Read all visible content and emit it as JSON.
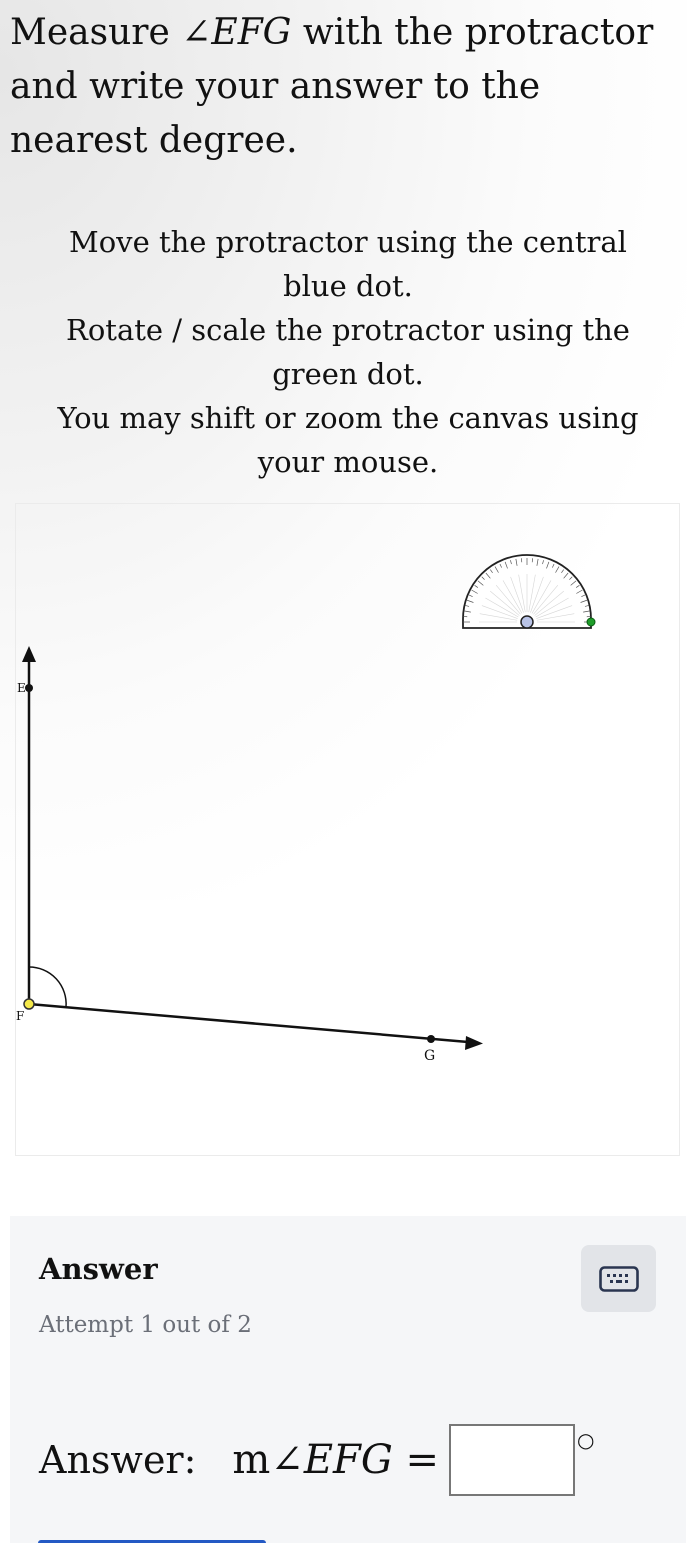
{
  "question": {
    "prefix": "Measure ",
    "angle_symbol": "∠",
    "angle_name": "EFG",
    "suffix": " with the protractor and write your answer to the nearest degree."
  },
  "instructions": [
    "Move the protractor using the central blue dot.",
    "Rotate / scale the protractor using the green dot.",
    "You may shift or zoom the canvas using your mouse."
  ],
  "canvas": {
    "points": {
      "E": "E",
      "F": "F",
      "G": "G"
    },
    "protractor": {
      "center_dot_color": "#b9c3e6",
      "handle_dot_color": "#1f9d2a"
    },
    "vertex_dot_color": "#f5e94a"
  },
  "answer_panel": {
    "title": "Answer",
    "attempt": "Attempt 1 out of 2",
    "keyboard_icon": "keyboard-icon",
    "label": "Answer:",
    "expression_prefix": "m∠",
    "expression_angle": "EFG",
    "equals": " =",
    "input_value": "",
    "degree_symbol": "○"
  },
  "colors": {
    "panel_bg": "#f5f6f8",
    "submit_accent": "#2359c4"
  }
}
